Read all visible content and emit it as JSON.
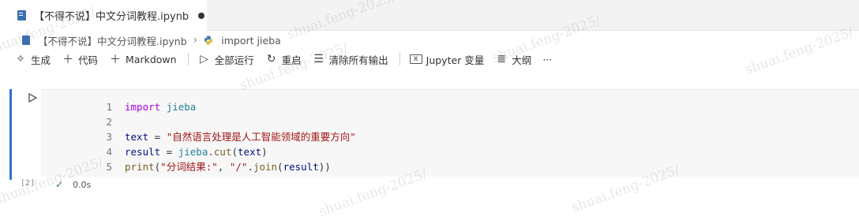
{
  "tab": {
    "title": "【不得不说】中文分词教程.ipynb",
    "modified": true
  },
  "breadcrumb": {
    "file": "【不得不说】中文分词教程.ipynb",
    "cell": "import jieba"
  },
  "toolbar": {
    "generate": "生成",
    "code": "代码",
    "markdown": "Markdown",
    "run_all": "全部运行",
    "restart": "重启",
    "clear_outputs": "清除所有输出",
    "variables": "Jupyter 变量",
    "outline": "大纲",
    "more": "···"
  },
  "cell": {
    "line_numbers": [
      "1",
      "2",
      "3",
      "4",
      "5"
    ],
    "lines": [
      [
        {
          "t": "import",
          "c": "kw"
        },
        {
          "t": " ",
          "c": "op"
        },
        {
          "t": "jieba",
          "c": "mod"
        }
      ],
      [],
      [
        {
          "t": "text",
          "c": "id"
        },
        {
          "t": " = ",
          "c": "op"
        },
        {
          "t": "\"自然语言处理是人工智能领域的重要方向\"",
          "c": "str"
        }
      ],
      [
        {
          "t": "result",
          "c": "id"
        },
        {
          "t": " = ",
          "c": "op"
        },
        {
          "t": "jieba",
          "c": "mod"
        },
        {
          "t": ".",
          "c": "op"
        },
        {
          "t": "cut",
          "c": "fn"
        },
        {
          "t": "(",
          "c": "op"
        },
        {
          "t": "text",
          "c": "id"
        },
        {
          "t": ")",
          "c": "op"
        }
      ],
      [
        {
          "t": "print",
          "c": "fn"
        },
        {
          "t": "(",
          "c": "op"
        },
        {
          "t": "\"分词结果:\"",
          "c": "str"
        },
        {
          "t": ", ",
          "c": "op"
        },
        {
          "t": "\"/\"",
          "c": "str"
        },
        {
          "t": ".",
          "c": "op"
        },
        {
          "t": "join",
          "c": "fn"
        },
        {
          "t": "(",
          "c": "op"
        },
        {
          "t": "result",
          "c": "id"
        },
        {
          "t": "))",
          "c": "op"
        }
      ]
    ],
    "execution_count": "[2]",
    "duration": "0.0s"
  },
  "watermark": "shuai.feng-2025/"
}
